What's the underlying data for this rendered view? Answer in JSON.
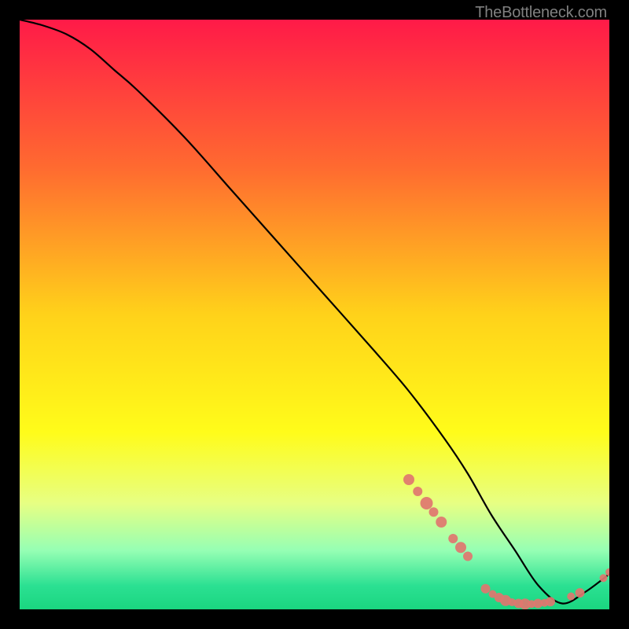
{
  "watermark": "TheBottleneck.com",
  "chart_data": {
    "type": "line",
    "title": "",
    "xlabel": "",
    "ylabel": "",
    "xlim": [
      0,
      100
    ],
    "ylim": [
      0,
      100
    ],
    "grid": false,
    "legend": false,
    "gradient_stops": [
      {
        "offset": 0,
        "color": "#ff1a48"
      },
      {
        "offset": 25,
        "color": "#ff6a30"
      },
      {
        "offset": 50,
        "color": "#ffd21a"
      },
      {
        "offset": 70,
        "color": "#fffc1a"
      },
      {
        "offset": 82,
        "color": "#e7ff83"
      },
      {
        "offset": 90,
        "color": "#96ffb4"
      },
      {
        "offset": 96,
        "color": "#2be092"
      },
      {
        "offset": 100,
        "color": "#1ad680"
      }
    ],
    "series": [
      {
        "name": "bottleneck-curve",
        "stroke": "#000000",
        "x": [
          0,
          4,
          8,
          12,
          16,
          20,
          28,
          36,
          44,
          52,
          60,
          66,
          72,
          76,
          80,
          84,
          88,
          92,
          96,
          100
        ],
        "y": [
          100,
          99,
          97.5,
          95,
          91.5,
          88,
          80,
          71,
          62,
          53,
          44,
          37,
          29,
          23,
          16,
          10,
          4,
          1,
          3,
          6
        ]
      }
    ],
    "scatter_clusters": [
      {
        "name": "cluster-left",
        "color": "#e0766f",
        "radius_range": [
          4,
          8
        ],
        "points": [
          {
            "x": 66,
            "y": 22,
            "r": 7
          },
          {
            "x": 67.5,
            "y": 20,
            "r": 6
          },
          {
            "x": 69,
            "y": 18,
            "r": 8
          },
          {
            "x": 70.2,
            "y": 16.5,
            "r": 6
          },
          {
            "x": 71.5,
            "y": 14.8,
            "r": 7
          },
          {
            "x": 73.5,
            "y": 12,
            "r": 6
          },
          {
            "x": 74.8,
            "y": 10.5,
            "r": 7
          },
          {
            "x": 76,
            "y": 9,
            "r": 6
          }
        ]
      },
      {
        "name": "cluster-mid",
        "color": "#e0766f",
        "radius_range": [
          4,
          8
        ],
        "points": [
          {
            "x": 79,
            "y": 3.5,
            "r": 6
          },
          {
            "x": 80.2,
            "y": 2.6,
            "r": 5
          },
          {
            "x": 81.3,
            "y": 2.0,
            "r": 6
          },
          {
            "x": 82.4,
            "y": 1.5,
            "r": 7
          },
          {
            "x": 83.5,
            "y": 1.2,
            "r": 5
          },
          {
            "x": 84.6,
            "y": 1.0,
            "r": 6
          },
          {
            "x": 85.7,
            "y": 0.9,
            "r": 7
          },
          {
            "x": 86.8,
            "y": 0.9,
            "r": 5
          },
          {
            "x": 87.9,
            "y": 1.0,
            "r": 6
          },
          {
            "x": 89.0,
            "y": 1.1,
            "r": 5
          },
          {
            "x": 90.0,
            "y": 1.3,
            "r": 6
          }
        ]
      },
      {
        "name": "cluster-right",
        "color": "#e0766f",
        "radius_range": [
          4,
          7
        ],
        "points": [
          {
            "x": 93.5,
            "y": 2.2,
            "r": 5
          },
          {
            "x": 95.0,
            "y": 2.8,
            "r": 6
          },
          {
            "x": 99.0,
            "y": 5.3,
            "r": 5
          },
          {
            "x": 100.0,
            "y": 6.3,
            "r": 5
          }
        ]
      }
    ]
  }
}
